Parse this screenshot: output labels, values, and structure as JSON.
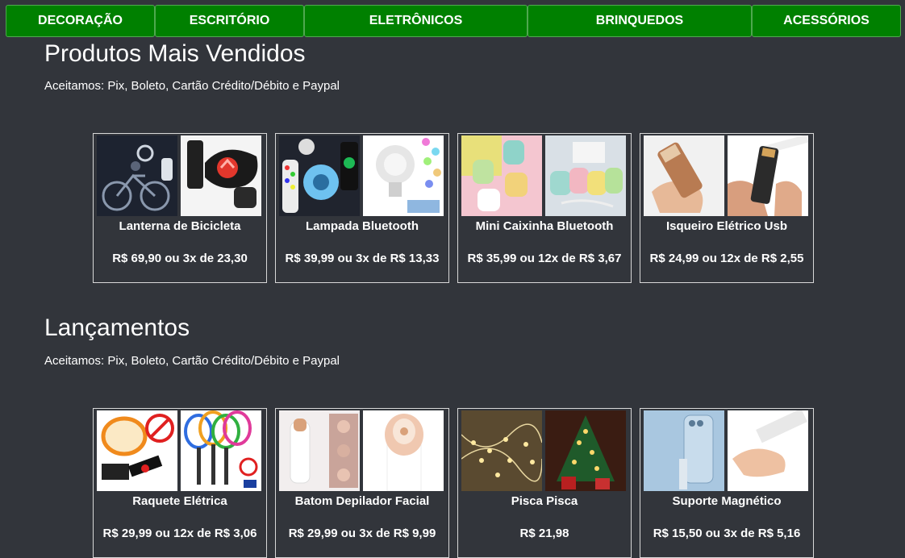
{
  "nav": {
    "items": [
      {
        "label": "DECORAÇÃO"
      },
      {
        "label": "ESCRITÓRIO"
      },
      {
        "label": "ELETRÔNICOS"
      },
      {
        "label": "BRINQUEDOS"
      },
      {
        "label": "ACESSÓRIOS"
      }
    ]
  },
  "sections": [
    {
      "title": "Produtos Mais Vendidos",
      "payment": "Aceitamos: Pix, Boleto, Cartão Crédito/Débito e Paypal",
      "products": [
        {
          "name": "Lanterna de Bicicleta",
          "price": "R$ 69,90 ou 3x de 23,30"
        },
        {
          "name": "Lampada Bluetooth",
          "price": "R$ 39,99 ou 3x de R$ 13,33"
        },
        {
          "name": "Mini Caixinha Bluetooth",
          "price": "R$ 35,99 ou 12x de R$ 3,67"
        },
        {
          "name": "Isqueiro Elétrico Usb",
          "price": "R$ 24,99 ou 12x de R$ 2,55"
        }
      ]
    },
    {
      "title": "Lançamentos",
      "payment": "Aceitamos: Pix, Boleto, Cartão Crédito/Débito e Paypal",
      "products": [
        {
          "name": "Raquete Elétrica",
          "price": "R$ 29,99 ou 12x de R$ 3,06"
        },
        {
          "name": "Batom Depilador Facial",
          "price": "R$ 29,99 ou 3x de R$ 9,99"
        },
        {
          "name": "Pisca Pisca",
          "price": "R$ 21,98"
        },
        {
          "name": "Suporte Magnético",
          "price": "R$ 15,50 ou 3x de R$ 5,16"
        }
      ]
    }
  ],
  "colors": {
    "background": "#32353b",
    "nav": "#008000",
    "text": "#ffffff"
  }
}
